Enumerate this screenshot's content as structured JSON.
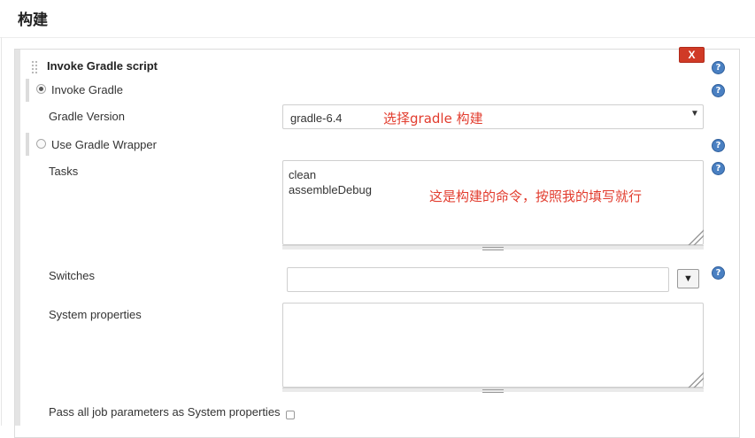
{
  "section": {
    "title": "构建"
  },
  "step": {
    "title": "Invoke Gradle script",
    "delete_label": "x",
    "help_glyph": "?"
  },
  "invoke_gradle": {
    "radio_label": "Invoke Gradle",
    "selected": true,
    "version_label": "Gradle Version",
    "version_value": "gradle-6.4",
    "version_annotation": "选择gradle 构建"
  },
  "use_wrapper": {
    "radio_label": "Use Gradle Wrapper",
    "selected": false
  },
  "tasks": {
    "label": "Tasks",
    "value": "clean\nassembleDebug",
    "annotation": "这是构建的命令，按照我的填写就行"
  },
  "switches": {
    "label": "Switches",
    "value": "",
    "expand_glyph": "▼"
  },
  "system_properties": {
    "label": "System properties",
    "value": ""
  },
  "pass_params": {
    "label": "Pass all job parameters as System properties",
    "checked": false
  },
  "colors": {
    "help_blue": "#4a80c2",
    "delete_red": "#d03a26",
    "annotation_red": "#e23c2e"
  },
  "icons": {
    "help": "help-icon",
    "dropdown": "chevron-down-icon",
    "drag": "drag-handle-icon"
  }
}
